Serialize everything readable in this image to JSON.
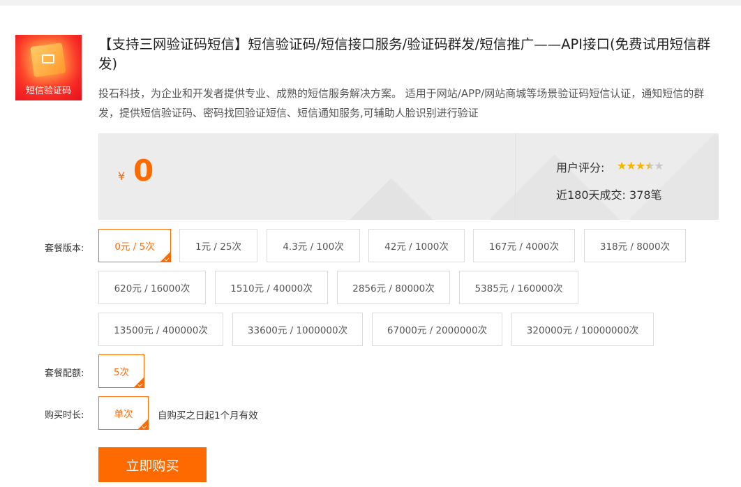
{
  "product": {
    "thumb_text": "短信验证码",
    "title": "【支持三网验证码短信】短信验证码/短信接口服务/验证码群发/短信推广——API接口(免费试用短信群发)",
    "description": "投石科技，为企业和开发者提供专业、成熟的短信服务解决方案。 适用于网站/APP/网站商城等场景验证码短信认证，通知短信的群发，提供短信验证码、密码找回验证短信、短信通知服务,可辅助人脸识别进行验证"
  },
  "price": {
    "currency": "¥",
    "value": "0",
    "rating_label": "用户评分:",
    "rating": 3.5,
    "rating_max": 5,
    "sales": "近180天成交: 378笔"
  },
  "package_version": {
    "label": "套餐版本:",
    "options": [
      "0元 / 5次",
      "1元 / 25次",
      "4.3元 / 100次",
      "42元 / 1000次",
      "167元 / 4000次",
      "318元 / 8000次",
      "620元 / 16000次",
      "1510元 / 40000次",
      "2856元 / 80000次",
      "5385元 / 160000次",
      "13500元 / 400000次",
      "33600元 / 1000000次",
      "67000元 / 2000000次",
      "320000元 / 10000000次"
    ],
    "selected": "0元 / 5次"
  },
  "package_quota": {
    "label": "套餐配额:",
    "value": "5次"
  },
  "duration": {
    "label": "购买时长:",
    "value": "单次",
    "note": "自购买之日起1个月有效"
  },
  "buy_button": "立即购买",
  "colors": {
    "accent": "#ff6a00",
    "star": "#f5b400",
    "panel_bg": "#ececec"
  }
}
